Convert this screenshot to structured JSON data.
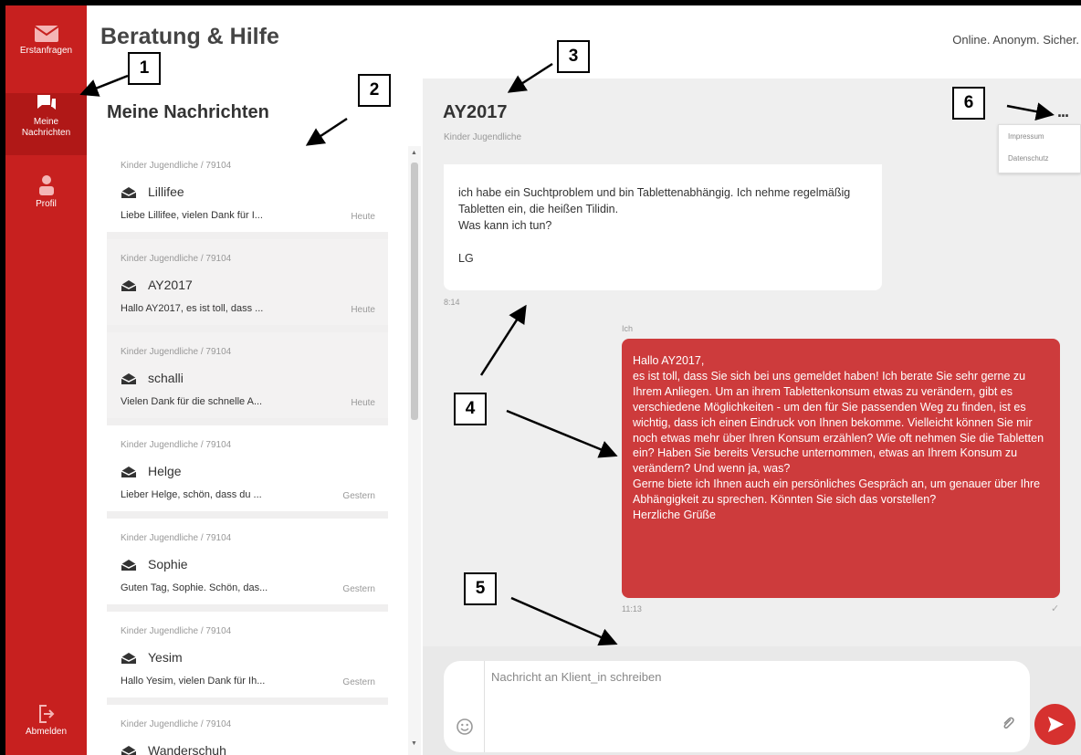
{
  "app": {
    "title": "Beratung & Hilfe",
    "claim": "Online. Anonym. Sicher.",
    "accent": "#c7201f"
  },
  "sidebar": {
    "items": [
      {
        "label": "Erstanfragen",
        "icon": "envelope-icon"
      },
      {
        "label": "Meine Nachrichten",
        "icon": "chat-bubbles-icon"
      },
      {
        "label": "Profil",
        "icon": "person-icon"
      },
      {
        "label": "Abmelden",
        "icon": "logout-icon"
      }
    ]
  },
  "list": {
    "title": "Meine Nachrichten",
    "sessions": [
      {
        "meta": "Kinder Jugendliche / 79104",
        "name": "Lillifee",
        "preview": "Liebe Lillifee, vielen Dank für I...",
        "date": "Heute"
      },
      {
        "meta": "Kinder Jugendliche / 79104",
        "name": "AY2017",
        "preview": "Hallo AY2017, es ist toll, dass ...",
        "date": "Heute"
      },
      {
        "meta": "Kinder Jugendliche / 79104",
        "name": "schalli",
        "preview": "Vielen Dank für die schnelle A...",
        "date": "Heute"
      },
      {
        "meta": "Kinder Jugendliche / 79104",
        "name": "Helge",
        "preview": "Lieber Helge, schön, dass du ...",
        "date": "Gestern"
      },
      {
        "meta": "Kinder Jugendliche / 79104",
        "name": "Sophie",
        "preview": "Guten Tag, Sophie. Schön, das...",
        "date": "Gestern"
      },
      {
        "meta": "Kinder Jugendliche / 79104",
        "name": "Yesim",
        "preview": "Hallo Yesim, vielen Dank für Ih...",
        "date": "Gestern"
      },
      {
        "meta": "Kinder Jugendliche / 79104",
        "name": "Wanderschuh",
        "preview": "",
        "date": ""
      }
    ]
  },
  "chat": {
    "title": "AY2017",
    "subtitle": "Kinder Jugendliche",
    "menu": {
      "more": "...",
      "items": [
        "Impressum",
        "Datenschutz"
      ]
    },
    "incoming": {
      "lines": [
        "ich habe ein Suchtproblem und bin Tablettenabhängig. Ich nehme regelmäßig Tabletten ein, die heißen Tilidin.",
        "Was kann ich tun?",
        "LG"
      ],
      "time": "8:14"
    },
    "outgoing": {
      "author": "Ich",
      "lines": [
        "Hallo AY2017,",
        "es ist toll, dass Sie sich bei uns gemeldet haben! Ich berate Sie sehr gerne zu Ihrem Anliegen. Um an ihrem Tablettenkonsum etwas zu verändern, gibt es verschiedene Möglichkeiten - um den für Sie passenden Weg zu finden, ist es wichtig, dass ich einen Eindruck von Ihnen bekomme. Vielleicht können Sie mir noch etwas mehr über Ihren Konsum erzählen? Wie oft nehmen Sie die Tabletten ein? Haben Sie bereits Versuche unternommen, etwas an Ihrem Konsum zu verändern? Und wenn ja, was?",
        "Gerne biete ich Ihnen auch ein persönliches Gespräch an, um genauer über Ihre Abhängigkeit zu sprechen. Könnten Sie sich das vorstellen?",
        "Herzliche Grüße"
      ],
      "time": "11:13",
      "status": "✓"
    },
    "composer": {
      "placeholder": "Nachricht an Klient_in schreiben"
    }
  },
  "annotations": [
    "1",
    "2",
    "3",
    "4",
    "5",
    "6"
  ]
}
